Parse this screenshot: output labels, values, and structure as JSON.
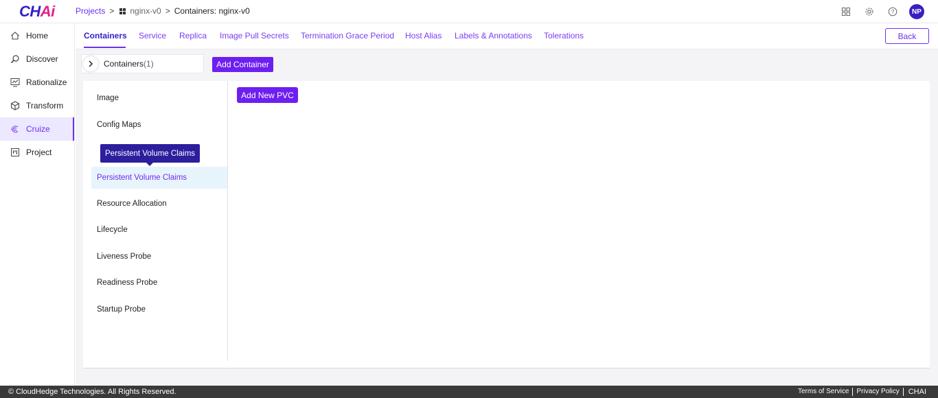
{
  "brand": {
    "logo_main": "CH",
    "logo_accent": "Ai"
  },
  "breadcrumb": {
    "projects": "Projects",
    "project": "nginx-v0",
    "current": "Containers: nginx-v0"
  },
  "user": {
    "initials": "NP"
  },
  "sidebar": {
    "items": [
      {
        "label": "Home",
        "icon": "home-icon"
      },
      {
        "label": "Discover",
        "icon": "search-icon"
      },
      {
        "label": "Rationalize",
        "icon": "chart-icon"
      },
      {
        "label": "Transform",
        "icon": "cube-icon"
      },
      {
        "label": "Cruize",
        "icon": "fingerprint-icon",
        "active": true
      },
      {
        "label": "Project",
        "icon": "board-icon"
      }
    ]
  },
  "tabs": {
    "items": [
      {
        "label": "Containers",
        "active": true
      },
      {
        "label": "Service"
      },
      {
        "label": "Replica"
      },
      {
        "label": "Image Pull Secrets"
      },
      {
        "label": "Termination Grace Period"
      },
      {
        "label": "Host Alias"
      },
      {
        "label": "Labels & Annotations"
      },
      {
        "label": "Tolerations"
      }
    ],
    "back_label": "Back"
  },
  "containers": {
    "label": "Containers",
    "count": "(1)",
    "add_label": "Add Container"
  },
  "menu": {
    "items": [
      "Image",
      "Config Maps",
      "Persistent Volume Claims",
      "Resource Allocation",
      "Lifecycle",
      "Liveness Probe",
      "Readiness Probe",
      "Startup Probe"
    ],
    "selected": "Persistent Volume Claims",
    "tooltip": "Persistent Volume Claims"
  },
  "pvc": {
    "add_label": "Add New PVC"
  },
  "footer": {
    "copyright": "© CloudHedge Technologies. All Rights Reserved.",
    "terms": "Terms of Service",
    "privacy": "Privacy Policy",
    "brand": "CHAI"
  },
  "colors": {
    "accent": "#6d2ef0",
    "brand_dark": "#3320c8",
    "footer_bg": "#3a3a3a"
  }
}
